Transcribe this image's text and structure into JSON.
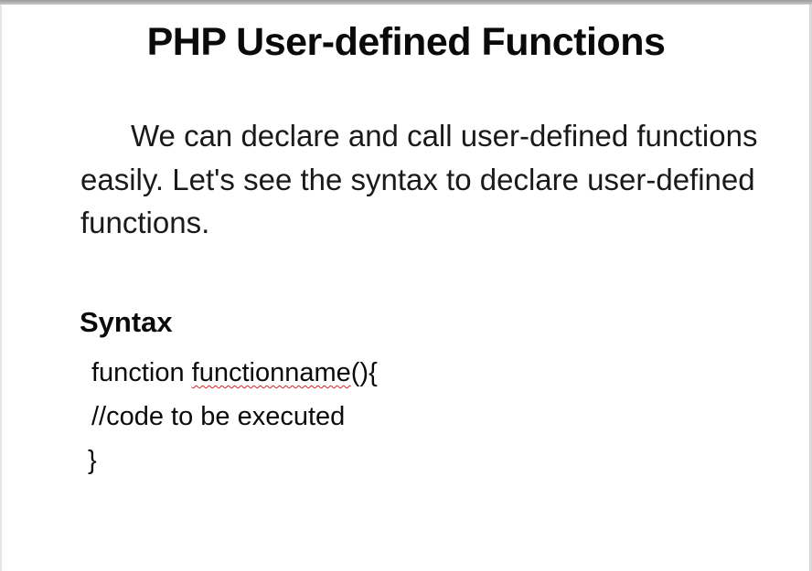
{
  "slide": {
    "title": "PHP User-defined Functions",
    "intro": "We can declare and call user-defined functions easily.  Let's see the syntax to declare user-defined functions.",
    "syntax_heading": "Syntax",
    "code": {
      "line1_prefix": "function ",
      "line1_misspelled": "functionname",
      "line1_suffix": "(){",
      "line2": "//code to be executed",
      "line3": "}"
    }
  }
}
